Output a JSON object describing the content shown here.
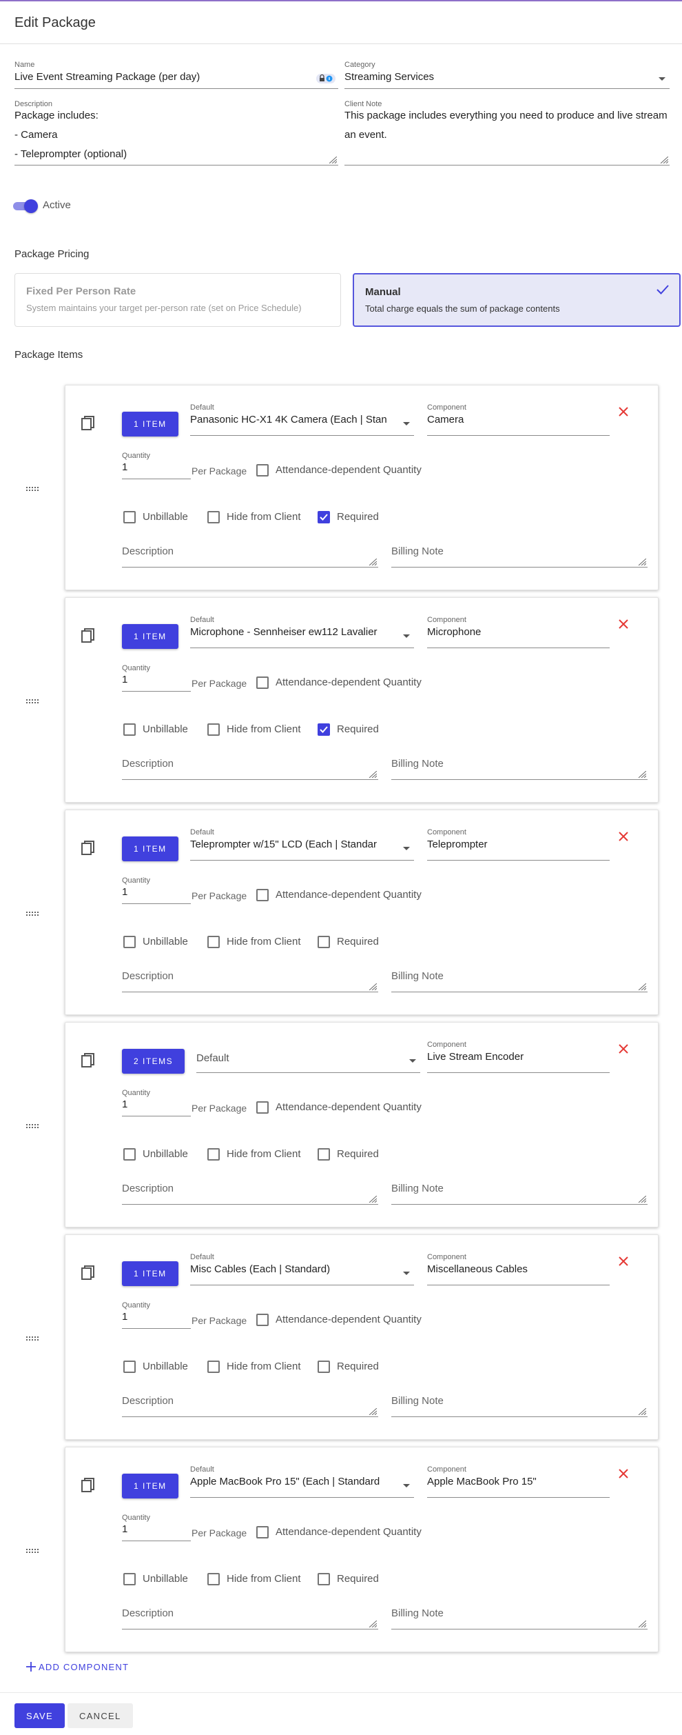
{
  "page": {
    "title": "Edit Package"
  },
  "form": {
    "name": {
      "label": "Name",
      "value": "Live Event Streaming Package (per day)"
    },
    "category": {
      "label": "Category",
      "value": "Streaming Services"
    },
    "description": {
      "label": "Description",
      "lines": [
        "Package includes:",
        "- Camera",
        "- Teleprompter (optional)"
      ]
    },
    "client_note": {
      "label": "Client Note",
      "lines": [
        "This package includes everything you need to produce and live stream",
        "an event."
      ]
    },
    "active_label": "Active"
  },
  "pricing": {
    "title": "Package Pricing",
    "fixed": {
      "title": "Fixed Per Person Rate",
      "desc": "System maintains your target per-person rate (set on Price Schedule)"
    },
    "manual": {
      "title": "Manual",
      "desc": "Total charge equals the sum of package contents",
      "selected": true
    }
  },
  "items_title": "Package Items",
  "labels": {
    "default": "Default",
    "component": "Component",
    "quantity": "Quantity",
    "per_package": "Per Package",
    "attendance": "Attendance-dependent Quantity",
    "unbillable": "Unbillable",
    "hide_client": "Hide from Client",
    "required": "Required",
    "description": "Description",
    "billing_note": "Billing Note"
  },
  "items": [
    {
      "button": "1 ITEM",
      "default": "Panasonic HC-X1 4K Camera (Each | Stan",
      "component": "Camera",
      "quantity": "1",
      "required": true
    },
    {
      "button": "1 ITEM",
      "default": "Microphone - Sennheiser ew112 Lavalier",
      "component": "Microphone",
      "quantity": "1",
      "required": true
    },
    {
      "button": "1 ITEM",
      "default": "Teleprompter w/15\" LCD (Each | Standar",
      "component": "Teleprompter",
      "quantity": "1",
      "required": false
    },
    {
      "button": "2 ITEMS",
      "default": "Default",
      "component": "Live Stream Encoder",
      "quantity": "1",
      "required": false
    },
    {
      "button": "1 ITEM",
      "default": "Misc Cables (Each | Standard)",
      "component": "Miscellaneous Cables",
      "quantity": "1",
      "required": false
    },
    {
      "button": "1 ITEM",
      "default": "Apple MacBook Pro 15\" (Each | Standard",
      "component": "Apple MacBook Pro 15\"",
      "quantity": "1",
      "required": false
    }
  ],
  "add_component": "ADD COMPONENT",
  "actions": {
    "save": "SAVE",
    "cancel": "CANCEL"
  },
  "colors": {
    "accent": "#4040de",
    "close": "#e53935",
    "selected_card_bg": "#e7e8f7"
  }
}
